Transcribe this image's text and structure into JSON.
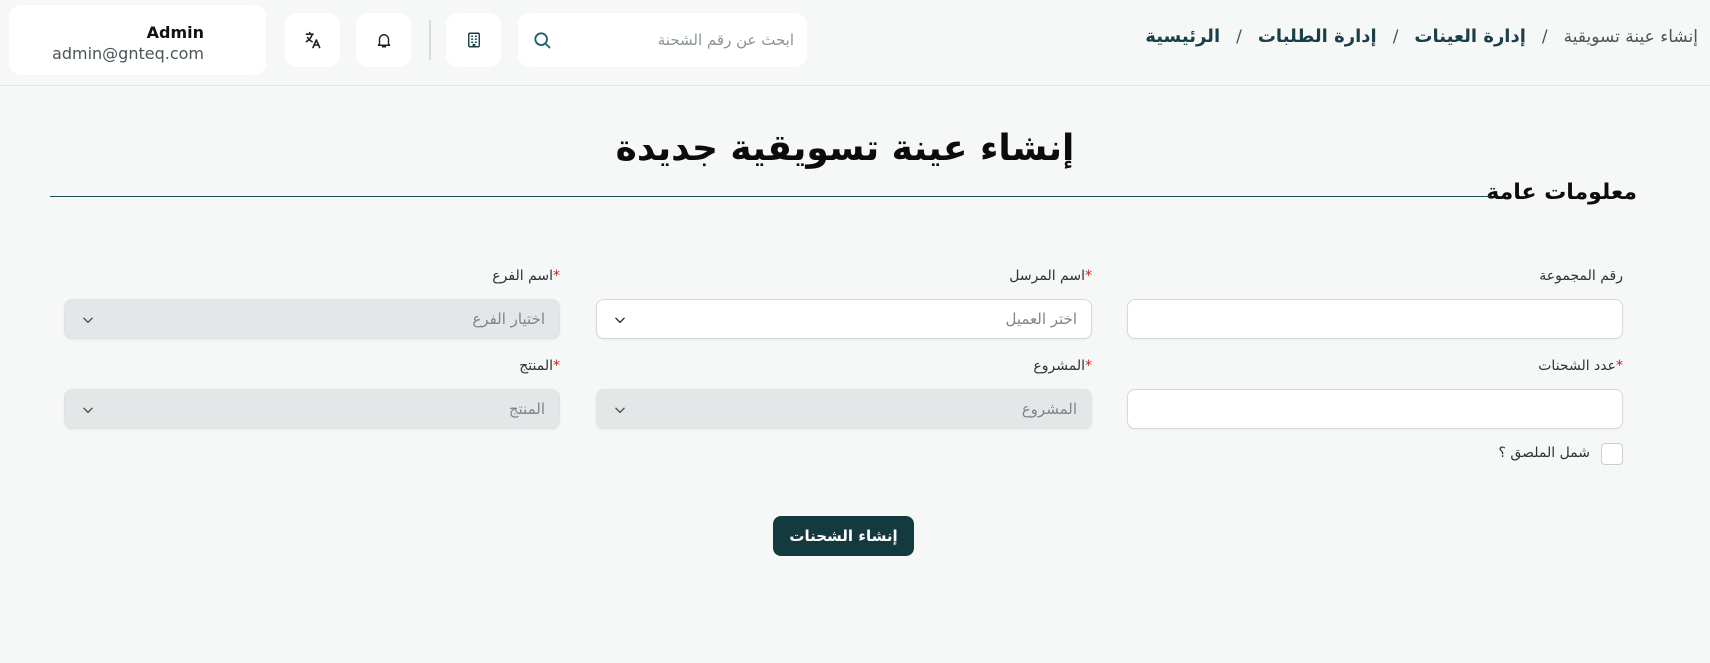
{
  "header": {
    "user": {
      "name": "Admin",
      "email": "admin@gnteq.com"
    },
    "icons": {
      "translate": "translate-icon",
      "notifications": "bell-icon",
      "company": "building-icon",
      "search": "search-icon"
    },
    "search": {
      "placeholder": "ابحث عن رقم الشحنة",
      "value": ""
    },
    "breadcrumb": [
      {
        "label": "الرئيسية"
      },
      {
        "label": "إدارة الطلبات"
      },
      {
        "label": "إدارة العينات"
      },
      {
        "label": "إنشاء عينة تسويقية"
      }
    ],
    "breadcrumb_separator": "/"
  },
  "page": {
    "title": "إنشاء عينة تسويقية جديدة",
    "section_title": "معلومات عامة"
  },
  "form": {
    "group_number": {
      "label": "رقم المجموعة",
      "value": "",
      "required": false
    },
    "sender_name": {
      "label": "اسم المرسل",
      "placeholder": "اختر العميل",
      "required": true,
      "disabled": false
    },
    "branch_name": {
      "label": "اسم الفرع",
      "placeholder": "اختيار الفرع",
      "required": true,
      "disabled": true
    },
    "shipment_count": {
      "label": "عدد الشحنات",
      "value": "",
      "required": true
    },
    "project": {
      "label": "المشروع",
      "placeholder": "المشروع",
      "required": true,
      "disabled": true
    },
    "product": {
      "label": "المنتج",
      "placeholder": "المنتج",
      "required": true,
      "disabled": true
    },
    "include_label": {
      "label": "شمل الملصق ؟",
      "checked": false
    },
    "required_mark": "*",
    "submit_label": "إنشاء الشحنات"
  },
  "colors": {
    "primary": "#143a3f",
    "required": "#d9141d",
    "divider": "#1f4a57",
    "background": "#f6f7f7"
  }
}
